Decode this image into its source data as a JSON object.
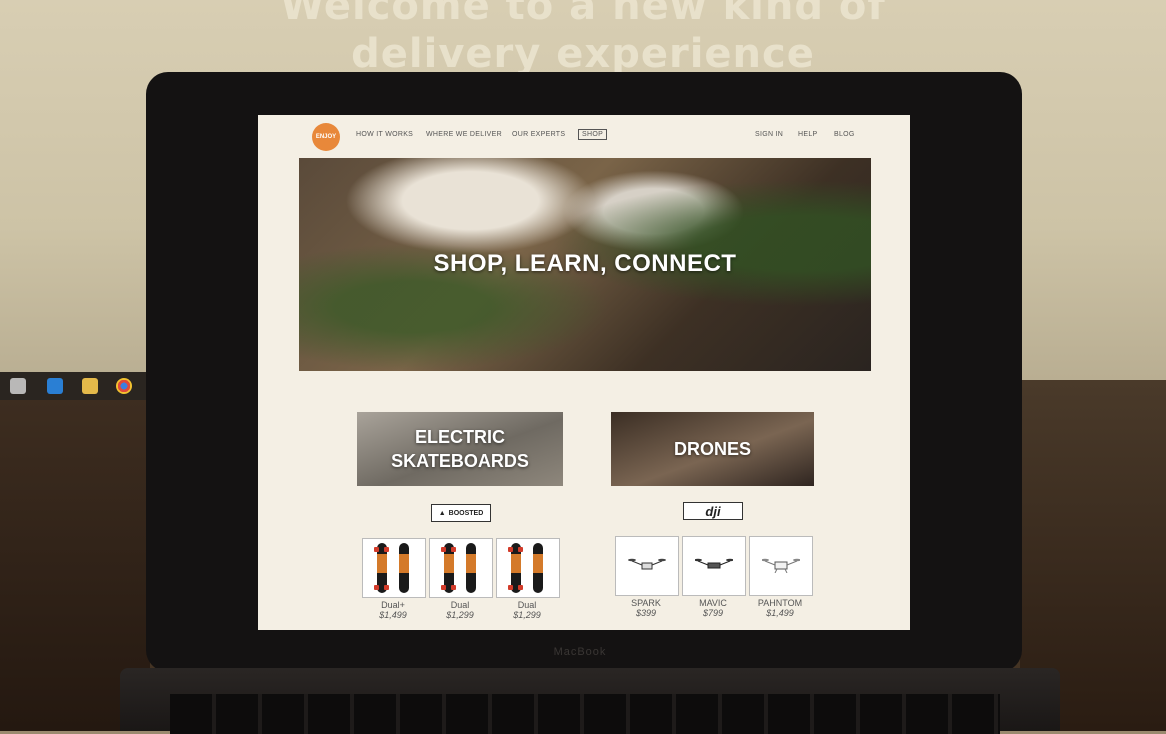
{
  "background": {
    "heading_line1": "Welcome to a new kind of",
    "heading_line2": "delivery experience"
  },
  "site": {
    "logo_text": "ENJOY",
    "nav": {
      "how_it_works": "HOW IT WORKS",
      "where_we_deliver": "WHERE WE DELIVER",
      "our_experts": "OUR EXPERTS",
      "shop": "SHOP",
      "sign_in": "SIGN IN",
      "help": "HELP",
      "blog": "BLOG"
    },
    "hero_title": "SHOP, LEARN, CONNECT",
    "categories": {
      "skateboards": "ELECTRIC SKATEBOARDS",
      "drones": "DRONES"
    },
    "brands": {
      "boosted": "BOOSTED",
      "dji": "dji"
    },
    "skateboards": [
      {
        "name": "Dual+",
        "price": "$1,499"
      },
      {
        "name": "Dual",
        "price": "$1,299"
      },
      {
        "name": "Dual",
        "price": "$1,299"
      }
    ],
    "drones": [
      {
        "name": "SPARK",
        "price": "$399"
      },
      {
        "name": "MAVIC",
        "price": "$799"
      },
      {
        "name": "PAHNTOM",
        "price": "$1,499"
      }
    ],
    "colors": {
      "accent": "#e8883a",
      "page_bg": "#f4efe4"
    }
  },
  "laptop": {
    "brand": "MacBook"
  }
}
